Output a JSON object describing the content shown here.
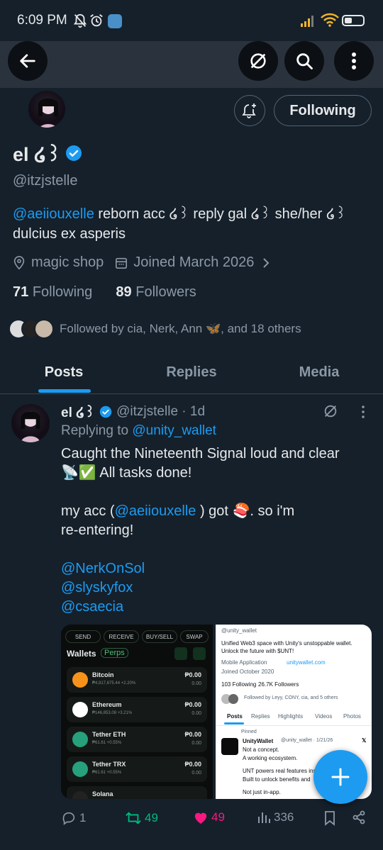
{
  "status_bar": {
    "time": "6:09 PM",
    "battery": "42"
  },
  "header": {
    "back_label": "Back",
    "bell_label": "Notifications",
    "follow_label": "Following"
  },
  "profile": {
    "display_name": "el ໒꒱",
    "handle": "@itzjstelle",
    "bio_mention": "@aeiiouxelle",
    "bio_text": " reborn acc ໒꒱ reply gal ໒꒱ she/her ໒꒱ dulcius ex asperis",
    "location": "magic shop",
    "joined": "Joined March 2026",
    "following_count": "71",
    "following_label": "Following",
    "followers_count": "89",
    "followers_label": "Followers",
    "followed_by": "Followed by cia, Nerk, Ann 🦋, and 18 others"
  },
  "tabs": [
    {
      "label": "Posts"
    },
    {
      "label": "Replies"
    },
    {
      "label": "Media"
    }
  ],
  "tweet": {
    "name": "el ໒꒱",
    "handle": "@itzjstelle · 1d",
    "replying_prefix": "Replying to ",
    "replying_handle": "@unity_wallet",
    "line1": "Caught the Nineteenth Signal loud and clear",
    "line2": "📡✅ All tasks done!",
    "line3_prefix": "my acc (",
    "line3_mention": "@aeiiouxelle",
    "line3_suffix": " ) got 🍣. so i'm",
    "line4": "re-entering!",
    "mention1": "@NerkOnSol",
    "mention2": "@slyskyfox",
    "mention3": "@csaecia",
    "replies": "1",
    "retweets": "49",
    "likes": "49",
    "views": "336"
  },
  "image_left": {
    "tabs": [
      "SEND",
      "RECEIVE",
      "BUY/SELL",
      "SWAP"
    ],
    "wallets_label": "Wallets",
    "perps_label": "Perps",
    "rows": [
      {
        "name": "Bitcoin",
        "sub": "₱4,917,675.44 +2.20%",
        "val": "₱0.00",
        "val2": "0.00",
        "color": "#f7931a"
      },
      {
        "name": "Ethereum",
        "sub": "₱146,853.08 +3.21%",
        "val": "₱0.00",
        "val2": "0.00",
        "color": "#627eea"
      },
      {
        "name": "Tether  ETH",
        "sub": "₱61.61 +0.55%",
        "val": "₱0.00",
        "val2": "0.00",
        "color": "#26a17b"
      },
      {
        "name": "Tether  TRX",
        "sub": "₱61.61 +0.55%",
        "val": "₱0.00",
        "val2": "0.00",
        "color": "#26a17b"
      },
      {
        "name": "Solana",
        "sub": "",
        "val": "",
        "val2": "",
        "color": "#222222"
      }
    ]
  },
  "image_right": {
    "handle": "@unity_wallet",
    "bio1": "Unified Web3 space with Unity's unstoppable wallet.",
    "bio2": "Unlock the future with $UNT!",
    "app": "Mobile Application",
    "site": "unitywallet.com",
    "joined": "Joined October 2020",
    "following": "103 Following",
    "followers": "26.7K Followers",
    "followed_by": "Followed by Leyy, CONY, cia, and 5 others",
    "tabs": [
      "Posts",
      "Replies",
      "Highlights",
      "Videos",
      "Photos"
    ],
    "pinned": "Pinned",
    "post_name": "UnityWallet",
    "post_handle": "@unity_wallet · 1/21/26",
    "post_l1": "Not a concept.",
    "post_l2": "A working ecosystem.",
    "post_l3": "UNT powers real features insi",
    "post_l4": "Built to unlock benefits and",
    "post_l5": "Not just in-app."
  }
}
